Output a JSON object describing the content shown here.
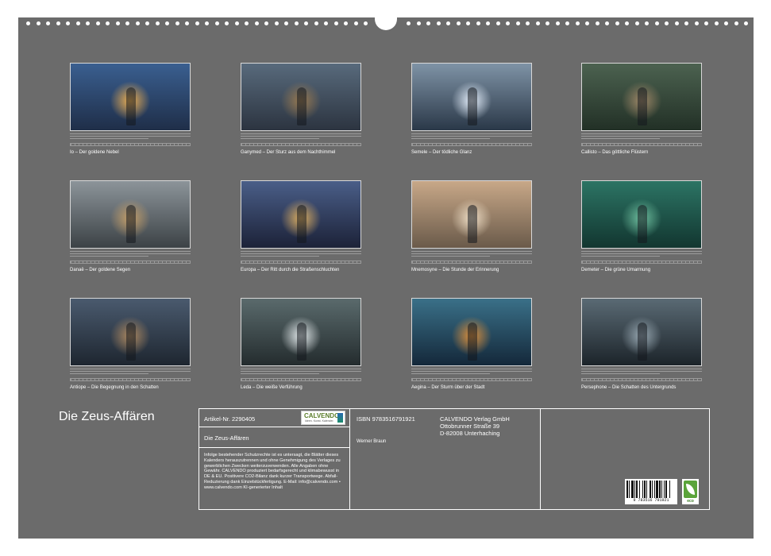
{
  "calendar": {
    "title": "Die Zeus-Affären",
    "months": [
      {
        "caption": "Io – Der goldene Nebel",
        "palette": [
          "#3a5f90",
          "#1f2e48",
          "#f0b050"
        ]
      },
      {
        "caption": "Ganymed – Der Sturz aus dem Nachthimmel",
        "palette": [
          "#586a7c",
          "#2c3440",
          "#9a7a50"
        ]
      },
      {
        "caption": "Semele – Der tödliche Glanz",
        "palette": [
          "#7f93a6",
          "#2a3848",
          "#e8f2ff"
        ]
      },
      {
        "caption": "Callisto – Das göttliche Flüstern",
        "palette": [
          "#4c6250",
          "#223026",
          "#a08868"
        ]
      },
      {
        "caption": "Danaë – Der goldene Segen",
        "palette": [
          "#8c949a",
          "#3c4246",
          "#c8a068"
        ]
      },
      {
        "caption": "Europa – Der Ritt durch die Straßenschluchten",
        "palette": [
          "#4a5e88",
          "#1c2238",
          "#e0b060"
        ]
      },
      {
        "caption": "Mnemosyne – Die Stunde der Erinnerung",
        "palette": [
          "#c8a888",
          "#6a5a4a",
          "#f0e0c8"
        ]
      },
      {
        "caption": "Demeter – Die grüne Umarmung",
        "palette": [
          "#2c7464",
          "#123630",
          "#70c0a0"
        ]
      },
      {
        "caption": "Antiope – Die Begegnung in den Schatten",
        "palette": [
          "#4a5a6e",
          "#1e2630",
          "#b08a60"
        ]
      },
      {
        "caption": "Leda – Die weiße Verführung",
        "palette": [
          "#5a6a6c",
          "#242c2e",
          "#e8eef0"
        ]
      },
      {
        "caption": "Aegina – Der Sturm über der Stadt",
        "palette": [
          "#3a7088",
          "#14283a",
          "#e0903a"
        ]
      },
      {
        "caption": "Persephone – Die Schatten des Untergrunds",
        "palette": [
          "#5a6a74",
          "#1c242a",
          "#9aaab4"
        ]
      }
    ]
  },
  "info": {
    "article": "Artikel-Nr. 2290405",
    "product_title": "Die Zeus-Affären",
    "copyright": "Infolge bestehender Schutzrechte ist es untersagt, die Blätter dieses Kalenders herauszutrennen und ohne Genehmigung des Verlages zu gewerblichen Zwecken weiterzuverwenden. Alle Angaben ohne Gewähr. CALVENDO produziert bedarfsgerecht und klimabewusst in DE & EU. Positivere CO2-Bilanz dank kurzer Transportwege. Abfall-Reduzierung dank Einzelstückfertigung. E-Mail: info@calvendo.com • www.calvendo.com KI-generierter Inhalt",
    "isbn": "ISBN 9783516791921",
    "author": "Werner Braun",
    "publisher_name": "CALVENDO Verlag GmbH",
    "publisher_street": "Ottobrunner Straße 39",
    "publisher_city": "D-82008 Unterhaching",
    "barcode_number": "9 783516 791921",
    "logo_brand": "CALVENDO",
    "logo_tagline": "Ideen. Kunst. Kalender.",
    "eco_label": "eco"
  }
}
